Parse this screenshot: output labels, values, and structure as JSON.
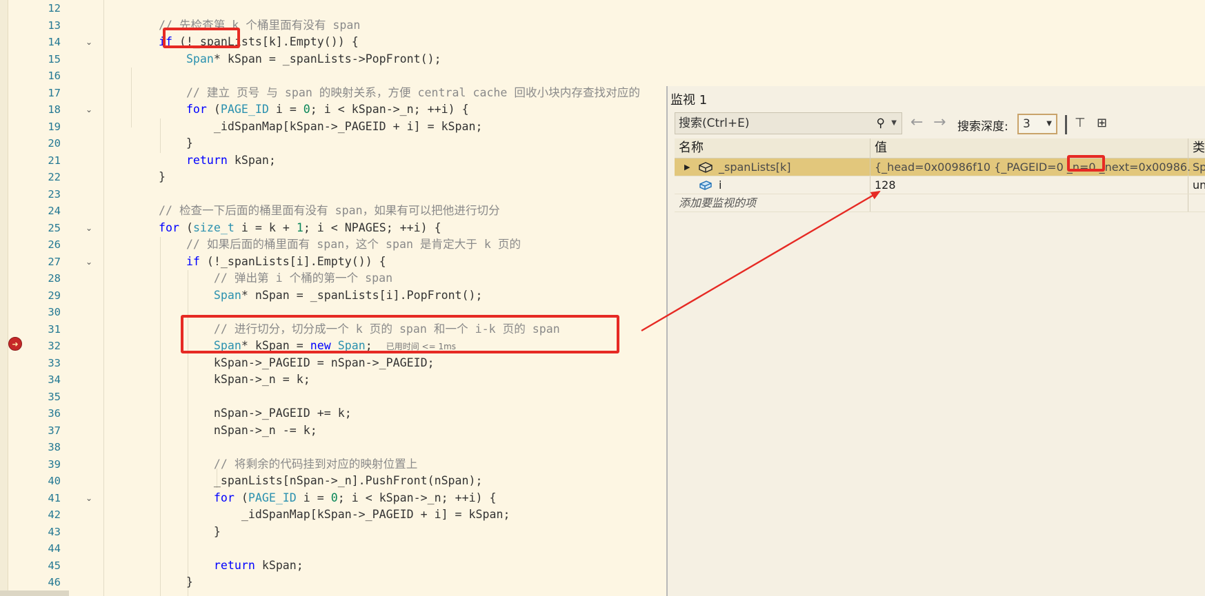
{
  "editor": {
    "lines": [
      {
        "n": "12",
        "fold": false,
        "segs": []
      },
      {
        "n": "13",
        "fold": false,
        "segs": [
          {
            "t": "    "
          },
          {
            "t": "// 先检查第 k 个桶里面有没有 span",
            "c": "cm"
          }
        ]
      },
      {
        "n": "14",
        "fold": true,
        "segs": [
          {
            "t": "    "
          },
          {
            "t": "if",
            "c": "kw"
          },
          {
            "t": " (!_spanLists[k].Empty()) {"
          }
        ]
      },
      {
        "n": "15",
        "fold": false,
        "segs": [
          {
            "t": "        "
          },
          {
            "t": "Span",
            "c": "ty"
          },
          {
            "t": "* kSpan = _spanLists->PopFront();"
          }
        ]
      },
      {
        "n": "16",
        "fold": false,
        "segs": []
      },
      {
        "n": "17",
        "fold": false,
        "segs": [
          {
            "t": "        "
          },
          {
            "t": "// 建立 页号 与 span 的映射关系，方便 central cache 回收小块内存查找对应的",
            "c": "cm"
          }
        ]
      },
      {
        "n": "18",
        "fold": true,
        "segs": [
          {
            "t": "        "
          },
          {
            "t": "for",
            "c": "kw"
          },
          {
            "t": " ("
          },
          {
            "t": "PAGE_ID",
            "c": "ty"
          },
          {
            "t": " i = "
          },
          {
            "t": "0",
            "c": "num"
          },
          {
            "t": "; i < kSpan->_n; ++i) {"
          }
        ]
      },
      {
        "n": "19",
        "fold": false,
        "segs": [
          {
            "t": "            _idSpanMap[kSpan->_PAGEID + i] = kSpan;"
          }
        ]
      },
      {
        "n": "20",
        "fold": false,
        "segs": [
          {
            "t": "        }"
          }
        ]
      },
      {
        "n": "21",
        "fold": false,
        "segs": [
          {
            "t": "        "
          },
          {
            "t": "return",
            "c": "kw"
          },
          {
            "t": " kSpan;"
          }
        ]
      },
      {
        "n": "22",
        "fold": false,
        "segs": [
          {
            "t": "    }"
          }
        ]
      },
      {
        "n": "23",
        "fold": false,
        "segs": []
      },
      {
        "n": "24",
        "fold": false,
        "segs": [
          {
            "t": "    "
          },
          {
            "t": "// 检查一下后面的桶里面有没有 span，如果有可以把他进行切分",
            "c": "cm"
          }
        ]
      },
      {
        "n": "25",
        "fold": true,
        "segs": [
          {
            "t": "    "
          },
          {
            "t": "for",
            "c": "kw"
          },
          {
            "t": " ("
          },
          {
            "t": "size_t",
            "c": "ty"
          },
          {
            "t": " i = k + "
          },
          {
            "t": "1",
            "c": "num"
          },
          {
            "t": "; i < NPAGES; ++i) {"
          }
        ]
      },
      {
        "n": "26",
        "fold": false,
        "segs": [
          {
            "t": "        "
          },
          {
            "t": "// 如果后面的桶里面有 span，这个 span 是肯定大于 k 页的",
            "c": "cm"
          }
        ]
      },
      {
        "n": "27",
        "fold": true,
        "segs": [
          {
            "t": "        "
          },
          {
            "t": "if",
            "c": "kw"
          },
          {
            "t": " (!_spanLists[i].Empty()) {"
          }
        ]
      },
      {
        "n": "28",
        "fold": false,
        "segs": [
          {
            "t": "            "
          },
          {
            "t": "// 弹出第 i 个桶的第一个 span",
            "c": "cm"
          }
        ]
      },
      {
        "n": "29",
        "fold": false,
        "segs": [
          {
            "t": "            "
          },
          {
            "t": "Span",
            "c": "ty"
          },
          {
            "t": "* nSpan = _spanLists[i].PopFront();"
          }
        ]
      },
      {
        "n": "30",
        "fold": false,
        "segs": []
      },
      {
        "n": "31",
        "fold": false,
        "segs": [
          {
            "t": "            "
          },
          {
            "t": "// 进行切分，切分成一个 k 页的 span 和一个 i-k 页的 span",
            "c": "cm"
          }
        ]
      },
      {
        "n": "32",
        "fold": false,
        "segs": [
          {
            "t": "            "
          },
          {
            "t": "Span",
            "c": "ty"
          },
          {
            "t": "* kSpan = "
          },
          {
            "t": "new",
            "c": "kw"
          },
          {
            "t": " "
          },
          {
            "t": "Span",
            "c": "ty"
          },
          {
            "t": ";  "
          },
          {
            "t": "已用时间 <= 1ms",
            "c": "hint"
          }
        ]
      },
      {
        "n": "33",
        "fold": false,
        "segs": [
          {
            "t": "            kSpan->_PAGEID = nSpan->_PAGEID;"
          }
        ]
      },
      {
        "n": "34",
        "fold": false,
        "segs": [
          {
            "t": "            kSpan->_n = k;"
          }
        ]
      },
      {
        "n": "35",
        "fold": false,
        "segs": []
      },
      {
        "n": "36",
        "fold": false,
        "segs": [
          {
            "t": "            nSpan->_PAGEID += k;"
          }
        ]
      },
      {
        "n": "37",
        "fold": false,
        "segs": [
          {
            "t": "            nSpan->_n -= k;"
          }
        ]
      },
      {
        "n": "38",
        "fold": false,
        "segs": []
      },
      {
        "n": "39",
        "fold": false,
        "segs": [
          {
            "t": "            "
          },
          {
            "t": "// 将剩余的代码挂到对应的映射位置上",
            "c": "cm"
          }
        ]
      },
      {
        "n": "40",
        "fold": false,
        "segs": [
          {
            "t": "            _spanLists[nSpan->_n].PushFront(nSpan);"
          }
        ]
      },
      {
        "n": "41",
        "fold": true,
        "segs": [
          {
            "t": "            "
          },
          {
            "t": "for",
            "c": "kw"
          },
          {
            "t": " ("
          },
          {
            "t": "PAGE_ID",
            "c": "ty"
          },
          {
            "t": " i = "
          },
          {
            "t": "0",
            "c": "num"
          },
          {
            "t": "; i < kSpan->_n; ++i) {"
          }
        ]
      },
      {
        "n": "42",
        "fold": false,
        "segs": [
          {
            "t": "                _idSpanMap[kSpan->_PAGEID + i] = kSpan;"
          }
        ]
      },
      {
        "n": "43",
        "fold": false,
        "segs": [
          {
            "t": "            }"
          }
        ]
      },
      {
        "n": "44",
        "fold": false,
        "segs": []
      },
      {
        "n": "45",
        "fold": false,
        "segs": [
          {
            "t": "            "
          },
          {
            "t": "return",
            "c": "kw"
          },
          {
            "t": " kSpan;"
          }
        ]
      },
      {
        "n": "46",
        "fold": false,
        "segs": [
          {
            "t": "        }"
          }
        ]
      }
    ],
    "fold_glyph": "⌄",
    "breakpoint_glyph": "➜"
  },
  "watch": {
    "title": "监视 1",
    "search_placeholder": "搜索(Ctrl+E)",
    "search_icon": "⚲",
    "dropdown_glyph": "▼",
    "back_icon": "←",
    "forward_icon": "→",
    "depth_label": "搜索深度:",
    "depth_value": "3",
    "pin_icon": "⊤",
    "tree_icon": "⊞",
    "col_name": "名称",
    "col_value": "值",
    "col_type": "类",
    "rows": [
      {
        "name": "_spanLists[k]",
        "value": "{_head=0x00986f10 {_PAGEID=0 _n=0 _next=0x00986...",
        "type": "Sp",
        "expand": "▶"
      },
      {
        "name": "i",
        "value": "128",
        "type": "un",
        "expand": ""
      }
    ],
    "add_item": "添加要监视的项"
  },
  "colors": {
    "background": "#fdf6e3",
    "keyword": "#0000ff",
    "type": "#2b91af",
    "comment": "#8a8a8a",
    "number": "#098658",
    "annotation_red": "#e62a24",
    "selected_row": "#e2c77c"
  }
}
